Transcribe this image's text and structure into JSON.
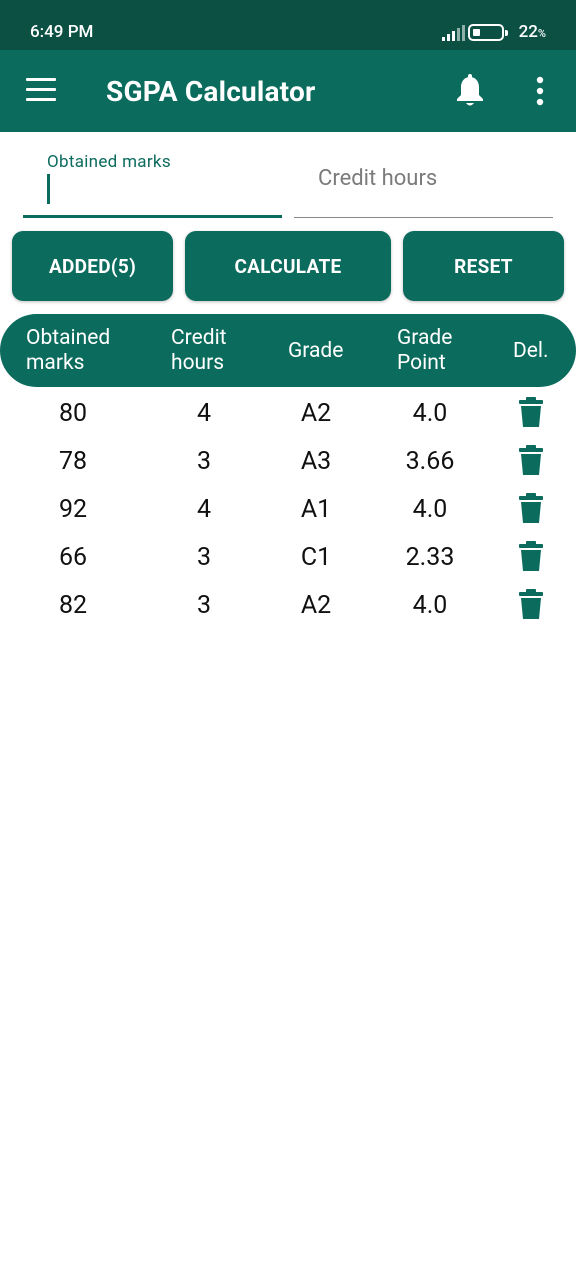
{
  "status_bar": {
    "time": "6:49 PM",
    "battery_value": "22",
    "battery_unit": "%"
  },
  "app_bar": {
    "title": "SGPA Calculator",
    "icons": [
      "menu-icon",
      "bell-icon",
      "more-vertical-icon"
    ]
  },
  "inputs": {
    "obtained_marks_label": "Obtained marks",
    "obtained_marks_value": "",
    "credit_hours_placeholder": "Credit hours",
    "credit_hours_value": ""
  },
  "buttons": {
    "added": "ADDED(5)",
    "calculate": "CALCULATE",
    "reset": "RESET"
  },
  "table": {
    "headers": {
      "obtained_marks_line1": "Obtained",
      "obtained_marks_line2": "marks",
      "credit_hours_line1": "Credit",
      "credit_hours_line2": "hours",
      "grade": "Grade",
      "grade_point_line1": "Grade",
      "grade_point_line2": "Point",
      "delete": "Del."
    },
    "rows": [
      {
        "marks": "80",
        "credit": "4",
        "grade": "A2",
        "point": "4.0"
      },
      {
        "marks": "78",
        "credit": "3",
        "grade": "A3",
        "point": "3.66"
      },
      {
        "marks": "92",
        "credit": "4",
        "grade": "A1",
        "point": "4.0"
      },
      {
        "marks": "66",
        "credit": "3",
        "grade": "C1",
        "point": "2.33"
      },
      {
        "marks": "82",
        "credit": "3",
        "grade": "A2",
        "point": "4.0"
      }
    ]
  },
  "colors": {
    "status_bar": "#0b5043",
    "primary": "#0b6b5d",
    "background": "#ffffff",
    "text": "#111111"
  }
}
